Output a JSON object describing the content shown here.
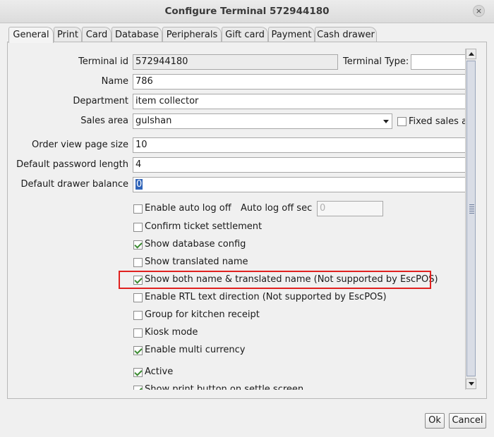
{
  "window": {
    "title": "Configure Terminal 572944180",
    "close_glyph": "×"
  },
  "tabs": [
    "General",
    "Print",
    "Card",
    "Database",
    "Peripherals",
    "Gift card",
    "Payment",
    "Cash drawer"
  ],
  "form": {
    "terminal_id_label": "Terminal id",
    "terminal_id_value": "572944180",
    "terminal_type_label": "Terminal Type:",
    "terminal_type_value": "",
    "name_label": "Name",
    "name_value": "786",
    "department_label": "Department",
    "department_value": "item collector",
    "sales_area_label": "Sales area",
    "sales_area_value": "gulshan",
    "fixed_sales_label": "Fixed sales a",
    "fixed_sales_checked": false,
    "order_view_label": "Order view page size",
    "order_view_value": "10",
    "password_length_label": "Default password length",
    "password_length_value": "4",
    "drawer_balance_label": "Default drawer balance",
    "drawer_balance_value": "0",
    "auto_log_off_sec_label": "Auto log off sec",
    "auto_log_off_sec_value": "0"
  },
  "options": [
    {
      "label": "Enable auto log off",
      "checked": false
    },
    {
      "label": "Confirm ticket settlement",
      "checked": false
    },
    {
      "label": "Show database config",
      "checked": true
    },
    {
      "label": "Show translated name",
      "checked": false
    },
    {
      "label": "Show both name & translated name (Not supported by EscPOS)",
      "checked": true
    },
    {
      "label": "Enable RTL text direction (Not supported by EscPOS)",
      "checked": false
    },
    {
      "label": "Group for kitchen receipt",
      "checked": false
    },
    {
      "label": "Kiosk mode",
      "checked": false
    },
    {
      "label": "Enable multi currency",
      "checked": true
    },
    {
      "label": "Active",
      "checked": true
    },
    {
      "label": "Show print button on settle screen",
      "checked": true
    }
  ],
  "buttons": {
    "ok": "Ok",
    "cancel": "Cancel"
  },
  "colors": {
    "highlight": "#e0211f",
    "check": "#3a8a30",
    "selection": "#2f63b8"
  }
}
